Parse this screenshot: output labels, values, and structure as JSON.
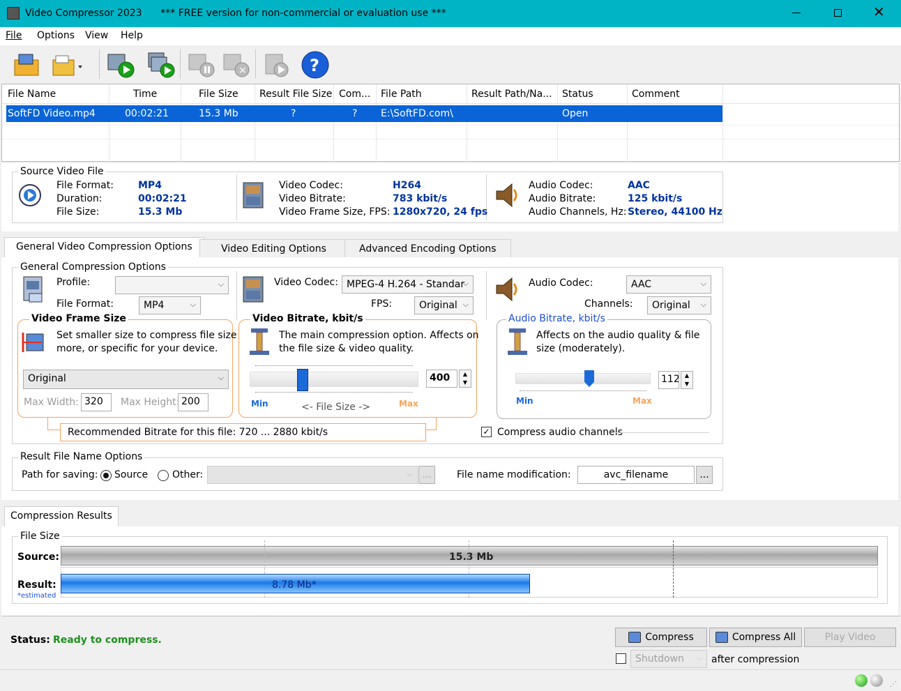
{
  "window": {
    "title": "Video Compressor 2023",
    "notice": "*** FREE version for non-commercial or evaluation use ***"
  },
  "menu": [
    "File",
    "Options",
    "View",
    "Help"
  ],
  "file_list": {
    "columns": [
      "File Name",
      "Time",
      "File Size",
      "Result File Size",
      "Com...",
      "File Path",
      "Result Path/Na...",
      "Status",
      "Comment"
    ],
    "rows": [
      [
        "SoftFD Video.mp4",
        "00:02:21",
        "15.3 Mb",
        "?",
        "?",
        "E:\\SoftFD.com\\",
        "",
        "Open",
        ""
      ]
    ]
  },
  "source": {
    "title": "Source Video File",
    "file_format_label": "File Format:",
    "file_format": "MP4",
    "duration_label": "Duration:",
    "duration": "00:02:21",
    "file_size_label": "File Size:",
    "file_size": "15.3 Mb",
    "video_codec_label": "Video Codec:",
    "video_codec": "H264",
    "video_bitrate_label": "Video Bitrate:",
    "video_bitrate": "783 kbit/s",
    "frame_label": "Video Frame Size, FPS:",
    "frame": "1280x720, 24 fps",
    "audio_codec_label": "Audio Codec:",
    "audio_codec": "AAC",
    "audio_bitrate_label": "Audio Bitrate:",
    "audio_bitrate": "125 kbit/s",
    "audio_channels_label": "Audio Channels, Hz:",
    "audio_channels": "Stereo, 44100 Hz"
  },
  "tabs": [
    "General Video Compression Options",
    "Video Editing Options",
    "Advanced Encoding Options"
  ],
  "general": {
    "title": "General Compression Options",
    "profile_label": "Profile:",
    "profile": "",
    "format_label": "File Format:",
    "format": "MP4",
    "vcodec_label": "Video Codec:",
    "vcodec": "MPEG-4 H.264 - Standar",
    "fps_label": "FPS:",
    "fps": "Original",
    "acodec_label": "Audio Codec:",
    "acodec": "AAC",
    "channels_label": "Channels:",
    "channels": "Original",
    "frame_title": "Video Frame Size",
    "frame_desc1": "Set smaller size to compress file size",
    "frame_desc2": "more, or specific for your device.",
    "frame_size": "Original",
    "max_width_label": "Max Width:",
    "max_width": "320",
    "max_height_label": "Max Height:",
    "max_height": "200",
    "vbit_title": "Video Bitrate, kbit/s",
    "vbit_desc1": "The main compression option. Affects on",
    "vbit_desc2": "the file size & video quality.",
    "vbit_value": "400",
    "vbit_fraction": 0.3,
    "min_label": "Min",
    "max_label": "Max",
    "filesize_label": "<-  File Size  ->",
    "abit_title": "Audio Bitrate, kbit/s",
    "abit_desc1": "Affects on the audio quality & file",
    "abit_desc2": "size (moderately).",
    "abit_value": "112",
    "abit_fraction": 0.55,
    "recommended": "Recommended Bitrate for this file: 720 ... 2880 kbit/s",
    "compress_audio_label": "Compress audio channels",
    "compress_audio": true
  },
  "result_name": {
    "title": "Result File Name Options",
    "path_label": "Path for saving:",
    "source_label": "Source",
    "other_label": "Other:",
    "mod_label": "File name modification:",
    "mod_value": "avc_filename",
    "browse": "..."
  },
  "results": {
    "tab": "Compression Results",
    "group": "File Size",
    "source_label": "Source:",
    "source_value": "15.3 Mb",
    "result_label": "Result:",
    "result_value": "8.78 Mb*",
    "estimated": "*estimated",
    "result_fraction": 0.574
  },
  "status": {
    "label": "Status:",
    "text": "Ready to compress."
  },
  "buttons": {
    "compress": "Compress",
    "compress_all": "Compress All",
    "play": "Play Video",
    "shutdown": "Shutdown",
    "after": "after compression"
  },
  "colors": {
    "title_bar": "#00b4c6",
    "selection": "#0a64d8",
    "value_text": "#0033a0",
    "status_ok": "#1e8f1e",
    "orange_frame": "#f5a45d",
    "link_blue": "#1a4fcf"
  }
}
